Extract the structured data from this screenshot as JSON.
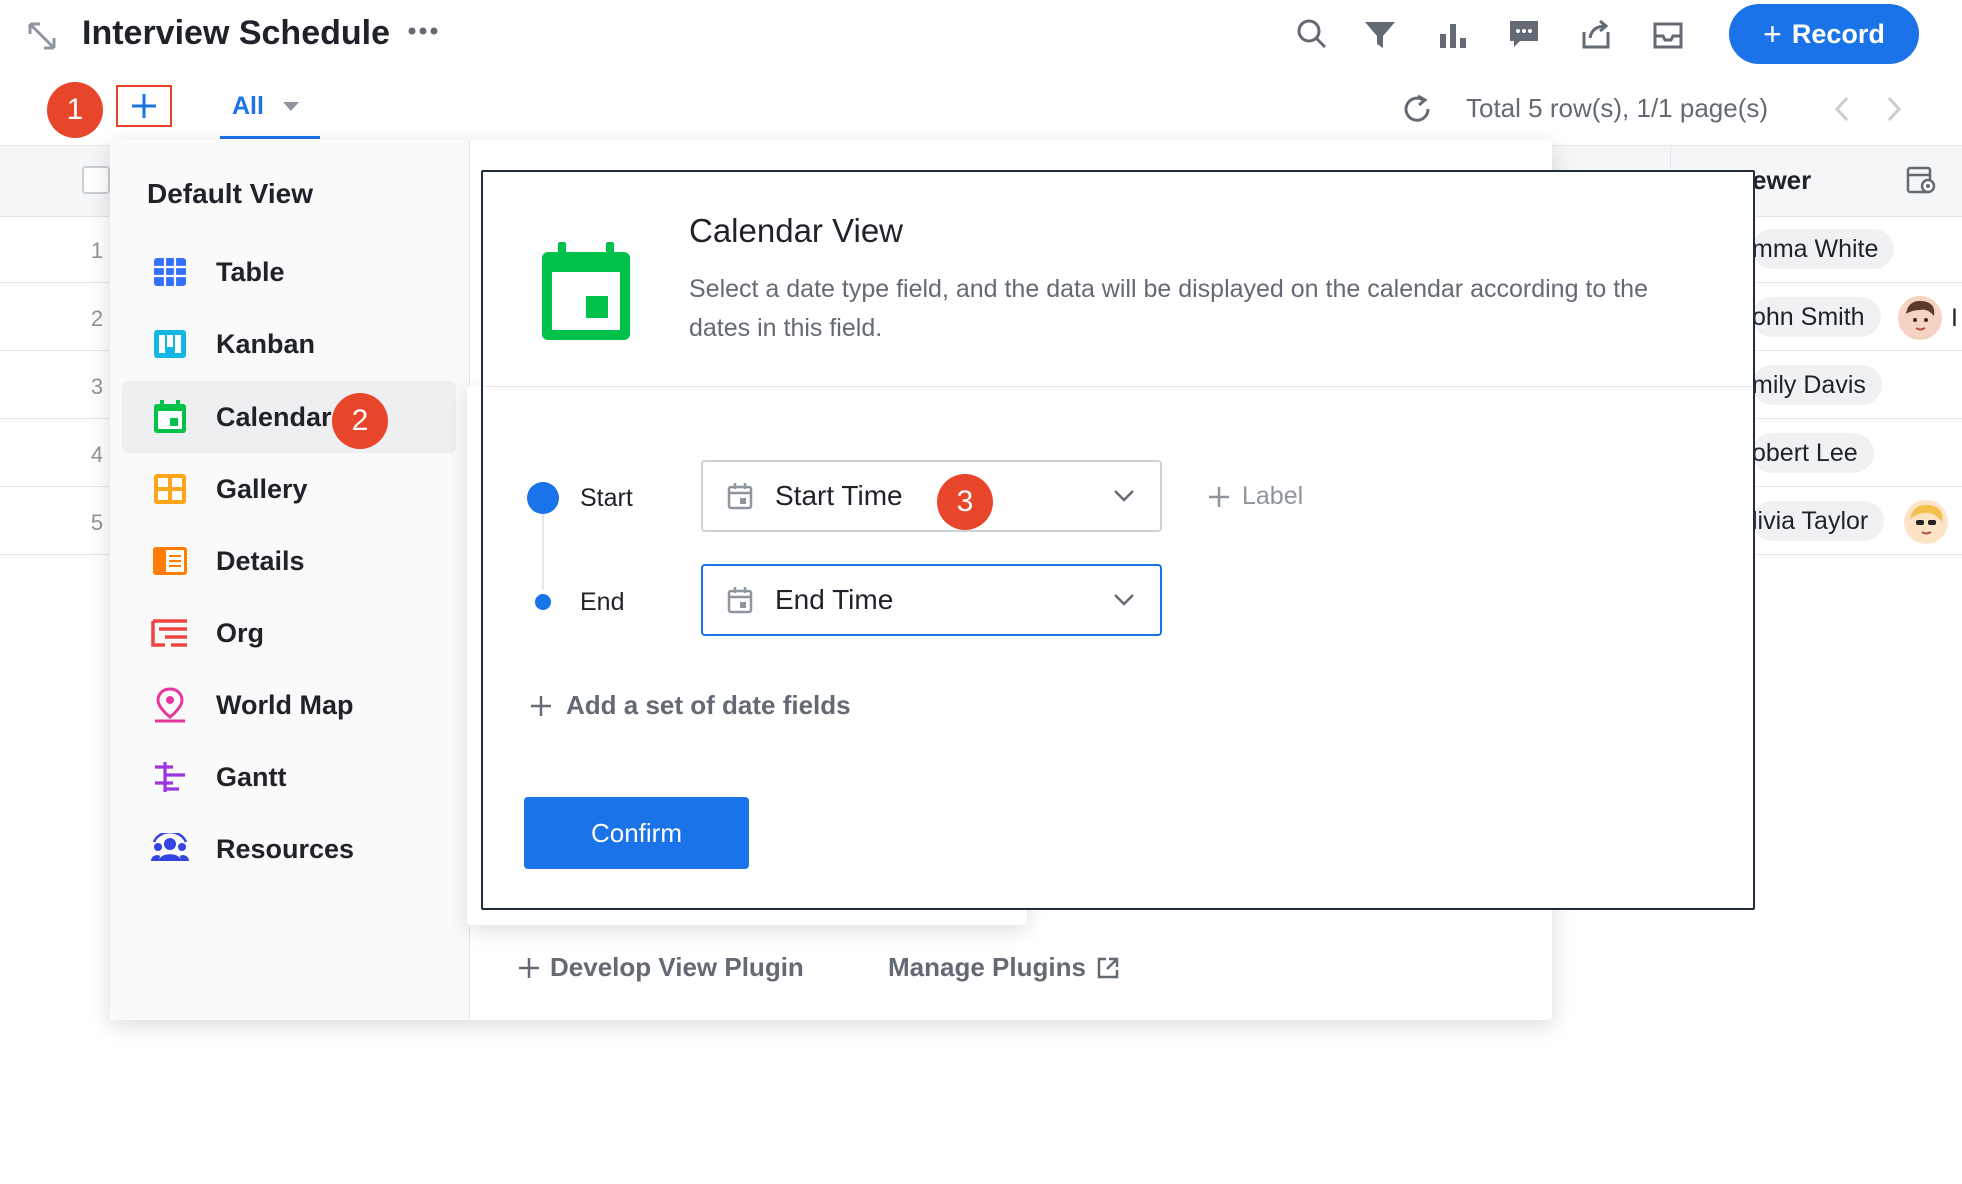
{
  "header": {
    "title": "Interview Schedule",
    "record_button": "Record"
  },
  "toolbar": {
    "tab_all": "All",
    "total_text": "Total 5 row(s), 1/1 page(s)"
  },
  "steps": [
    "1",
    "2",
    "3"
  ],
  "table": {
    "row_numbers": [
      "1",
      "2",
      "3",
      "4",
      "5"
    ],
    "column_header_fragment": "ewer",
    "interviewers": [
      "mma White",
      "ohn Smith",
      "mily Davis",
      "obert Lee",
      "livia Taylor"
    ],
    "overflow_fragment": "I"
  },
  "views": {
    "section_title": "Default View",
    "items": [
      {
        "label": "Table",
        "icon": "table-icon",
        "color": "#3370ff"
      },
      {
        "label": "Kanban",
        "icon": "kanban-icon",
        "color": "#14b6e3"
      },
      {
        "label": "Calendar",
        "icon": "calendar-icon",
        "color": "#00c14a"
      },
      {
        "label": "Gallery",
        "icon": "gallery-icon",
        "color": "#ffa51a"
      },
      {
        "label": "Details",
        "icon": "details-icon",
        "color": "#ff7d00"
      },
      {
        "label": "Org",
        "icon": "org-icon",
        "color": "#f04442"
      },
      {
        "label": "World Map",
        "icon": "map-pin-icon",
        "color": "#e6379d"
      },
      {
        "label": "Gantt",
        "icon": "gantt-icon",
        "color": "#9b35e0"
      },
      {
        "label": "Resources",
        "icon": "resources-icon",
        "color": "#3344e0"
      }
    ],
    "develop_plugin": "Develop View Plugin",
    "manage_plugins": "Manage Plugins"
  },
  "calendar_config": {
    "title": "Calendar View",
    "description": "Select a date type field, and the data will be displayed on the calendar according to the dates in this field.",
    "start_label": "Start",
    "start_field": "Start Time",
    "end_label": "End",
    "end_field": "End Time",
    "label_button": "Label",
    "add_fields": "Add a set of date fields",
    "confirm": "Confirm"
  },
  "colors": {
    "accent": "#1a73e8",
    "step_badge": "#e8462a",
    "calendar_green": "#00c14a"
  }
}
